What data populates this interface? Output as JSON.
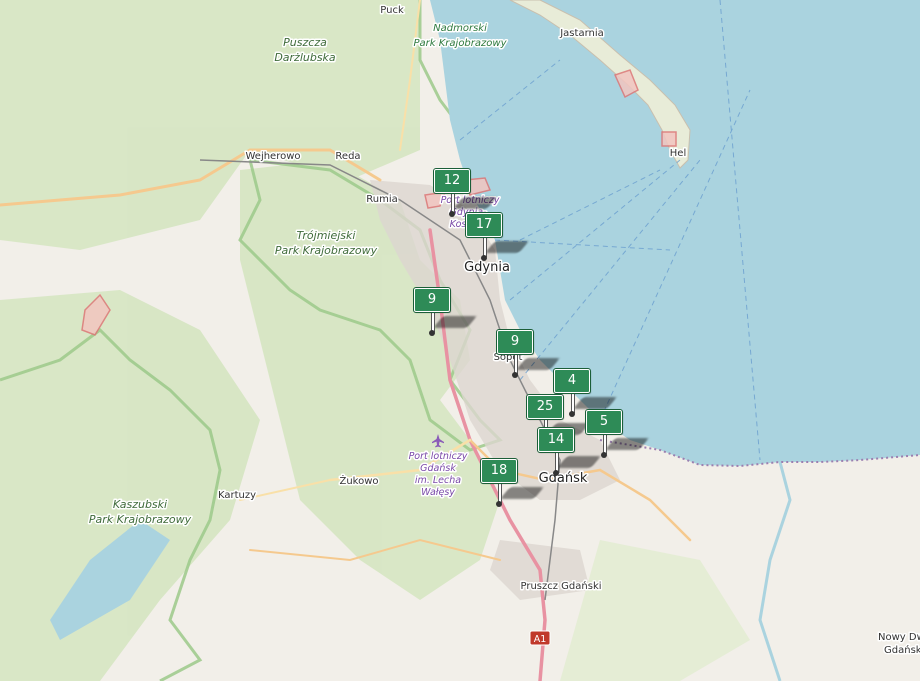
{
  "map": {
    "labels": {
      "puck": "Puck",
      "nadmorski_1": "Nadmorski",
      "nadmorski_2": "Park Krajobrazowy",
      "jastarnia": "Jastarnia",
      "hel": "Hel",
      "puszcza_1": "Puszcza",
      "puszcza_2": "Darżlubska",
      "wejherowo": "Wejherowo",
      "reda": "Reda",
      "rumia": "Rumia",
      "trojmiejski_1": "Trójmiejski",
      "trojmiejski_2": "Park Krajobrazowy",
      "port_gdynia_1": "Port lotniczy",
      "port_gdynia_2": "Gdynia-",
      "port_gdynia_3": "Kos",
      "gdynia": "Gdynia",
      "sopot": "Sopot",
      "port_gdansk_1": "Port lotniczy",
      "port_gdansk_2": "Gdańsk",
      "port_gdansk_3": "im. Lecha",
      "port_gdansk_4": "Wałęsy",
      "zukowo": "Żukowo",
      "kartuzy": "Kartuzy",
      "kaszubski_1": "Kaszubski",
      "kaszubski_2": "Park Krajobrazowy",
      "gdansk": "Gdańsk",
      "pruszcz": "Pruszcz Gdański",
      "road_a1": "A1",
      "nowy_dwor_1": "Nowy Dw",
      "nowy_dwor_2": "Gdańsk"
    },
    "colors": {
      "sea": "#aad3df",
      "land": "#f2efe9",
      "forest": "#c8dfb0",
      "park_border": "#8ac079",
      "marker": "#2e8b57"
    },
    "markers": [
      {
        "count": "12"
      },
      {
        "count": "17"
      },
      {
        "count": "9"
      },
      {
        "count": "9"
      },
      {
        "count": "4"
      },
      {
        "count": "25"
      },
      {
        "count": "5"
      },
      {
        "count": "14"
      },
      {
        "count": "18"
      }
    ]
  }
}
